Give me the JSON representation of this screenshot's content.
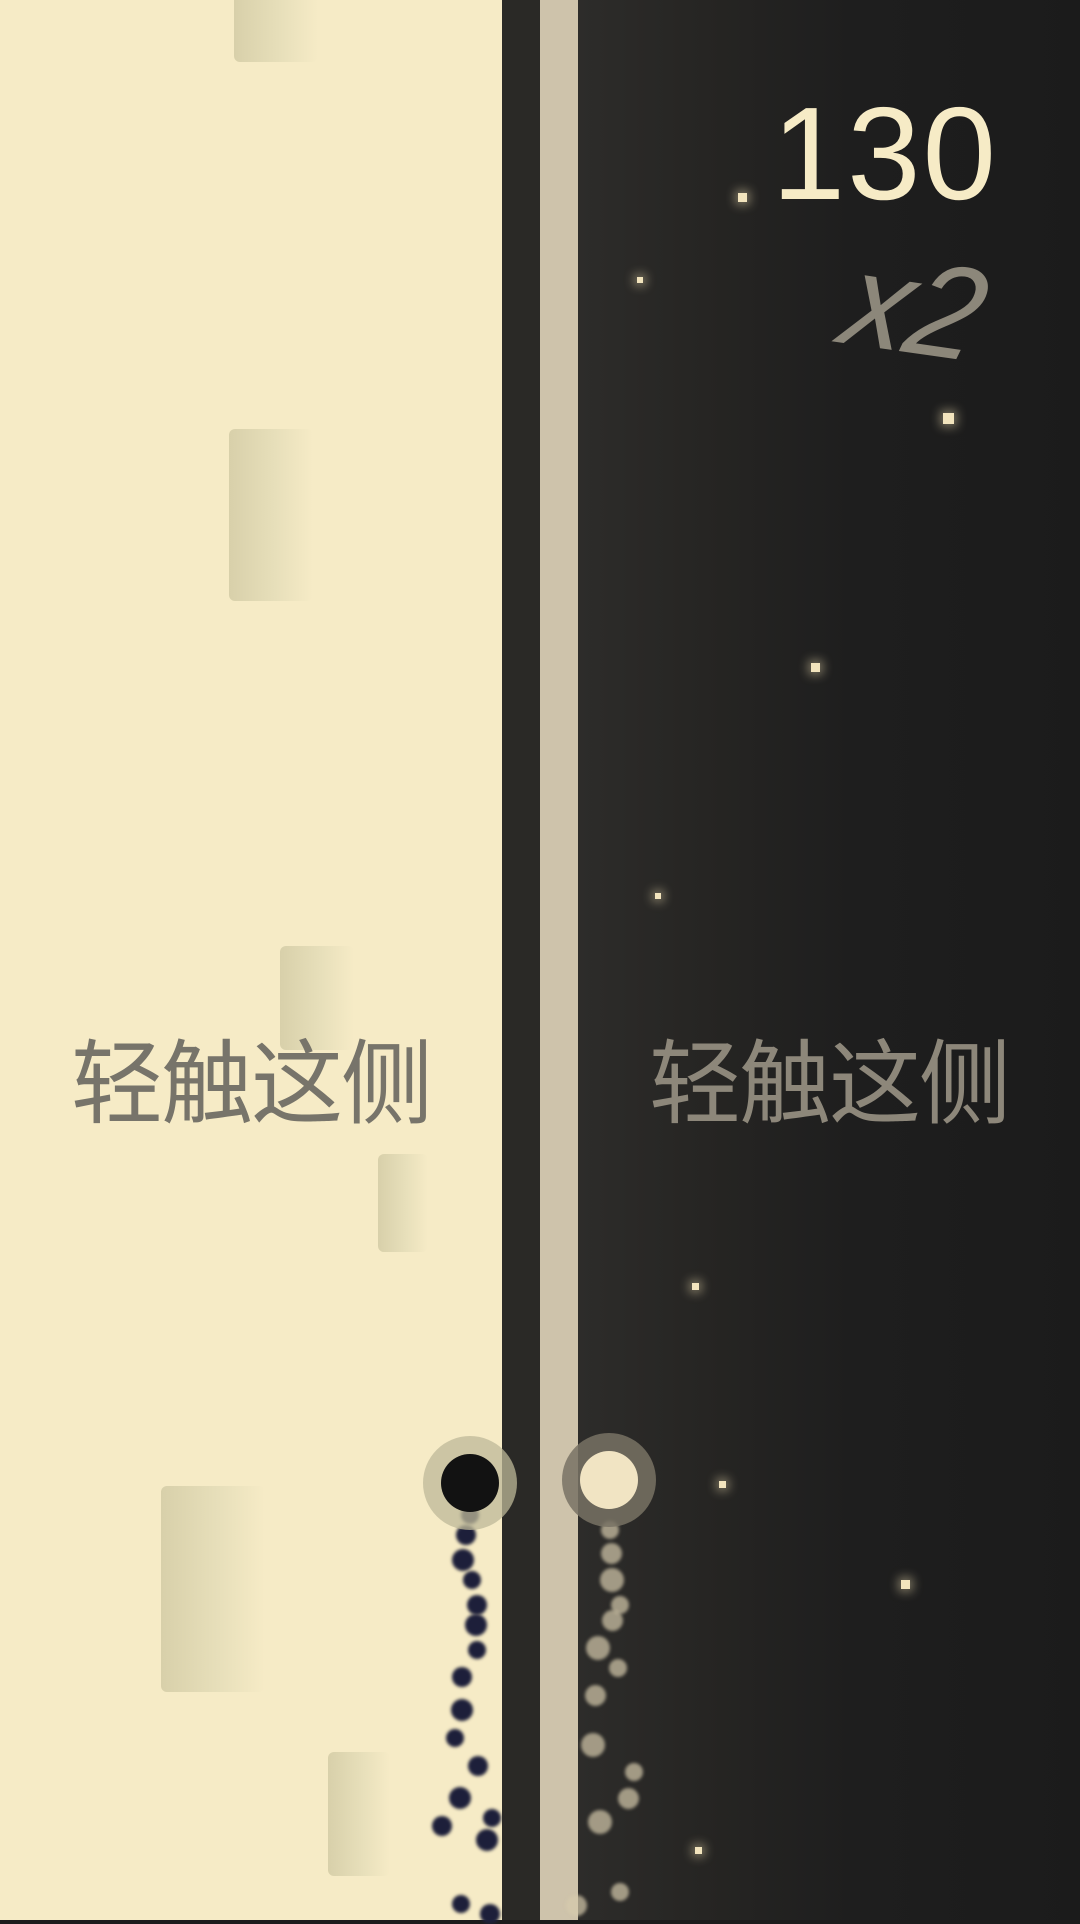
{
  "score": "130",
  "multiplier": "x2",
  "tap_hints": {
    "left": "轻触这侧",
    "right": "轻触这侧"
  },
  "colors": {
    "light_side": "#f6ebc6",
    "dark_side": "#1c1c1c",
    "lane": "#cec3ab",
    "dark_ball": "#121212",
    "light_ball": "#f1e4c3"
  }
}
